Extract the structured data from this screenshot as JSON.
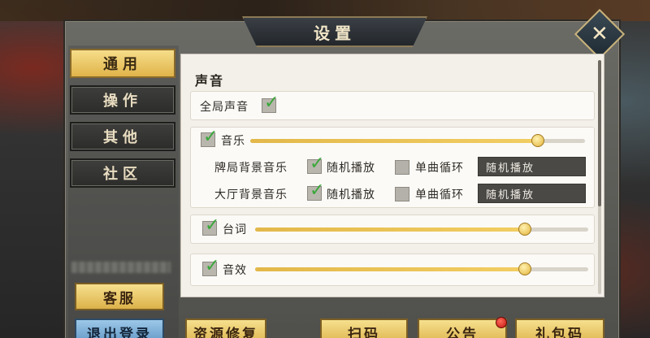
{
  "dialog": {
    "title": "设置",
    "close_icon": "close-x-icon"
  },
  "tabs": [
    {
      "label": "通用",
      "active": true
    },
    {
      "label": "操作",
      "active": false
    },
    {
      "label": "其他",
      "active": false
    },
    {
      "label": "社区",
      "active": false
    }
  ],
  "left_buttons": {
    "service": "客服",
    "logout": "退出登录"
  },
  "sound": {
    "section_title": "声音",
    "global_label": "全局声音",
    "global_checked": true,
    "music": {
      "label": "音乐",
      "checked": true,
      "volume": 0.86,
      "rows": [
        {
          "label": "牌局背景音乐",
          "random_label": "随机播放",
          "random_checked": true,
          "loop_label": "单曲循环",
          "loop_checked": false,
          "dropdown": "随机播放"
        },
        {
          "label": "大厅背景音乐",
          "random_label": "随机播放",
          "random_checked": true,
          "loop_label": "单曲循环",
          "loop_checked": false,
          "dropdown": "随机播放"
        }
      ]
    },
    "voice": {
      "label": "台词",
      "checked": true,
      "volume": 0.81
    },
    "effects": {
      "label": "音效",
      "checked": true,
      "volume": 0.81
    }
  },
  "bottom_buttons": {
    "repair": "资源修复",
    "scan": "扫码",
    "notice": "公告",
    "gift": "礼包码"
  },
  "colors": {
    "gold": "#e3b84a",
    "check_green": "#3aa83a",
    "notice_dot": "#c0140e"
  }
}
